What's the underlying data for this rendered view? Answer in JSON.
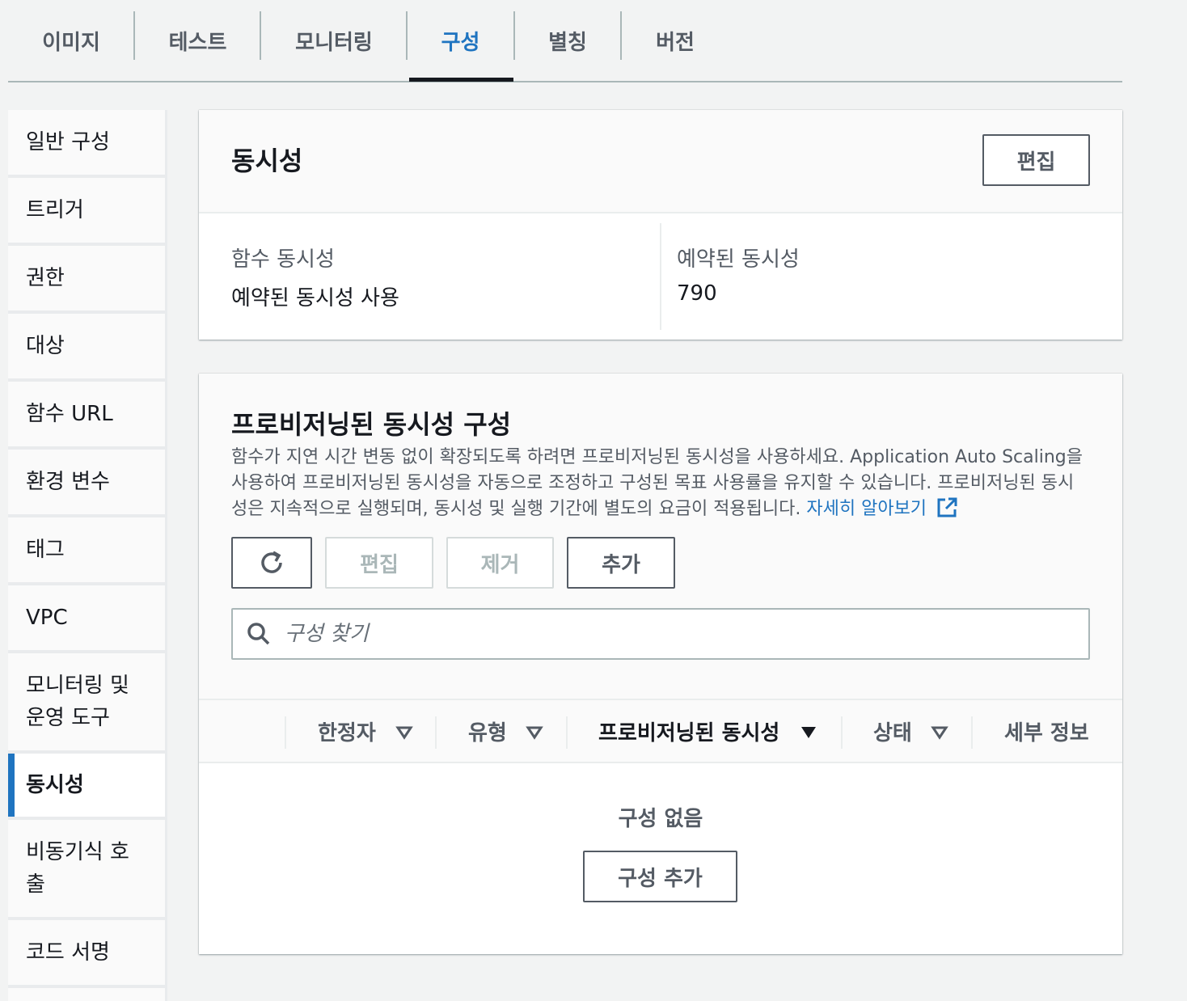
{
  "tabs": [
    "이미지",
    "테스트",
    "모니터링",
    "구성",
    "별칭",
    "버전"
  ],
  "active_tab": "구성",
  "sidebar": {
    "items": [
      {
        "label": "일반 구성"
      },
      {
        "label": "트리거"
      },
      {
        "label": "권한"
      },
      {
        "label": "대상"
      },
      {
        "label": "함수 URL"
      },
      {
        "label": "환경 변수"
      },
      {
        "label": "태그"
      },
      {
        "label": "VPC"
      },
      {
        "label": "모니터링 및 운영 도구"
      },
      {
        "label": "동시성"
      },
      {
        "label": "비동기식 호출"
      },
      {
        "label": "코드 서명"
      }
    ],
    "active": "동시성"
  },
  "concurrency": {
    "title": "동시성",
    "edit_label": "편집",
    "function_concurrency_label": "함수 동시성",
    "function_concurrency_value": "예약된 동시성 사용",
    "reserved_concurrency_label": "예약된 동시성",
    "reserved_concurrency_value": "790"
  },
  "provisioned": {
    "title": "프로비저닝된 동시성 구성",
    "description": "함수가 지연 시간 변동 없이 확장되도록 하려면 프로비저닝된 동시성을 사용하세요. Application Auto Scaling을 사용하여 프로비저닝된 동시성을 자동으로 조정하고 구성된 목표 사용률을 유지할 수 있습니다. 프로비저닝된 동시성은 지속적으로 실행되며, 동시성 및 실행 기간에 별도의 요금이 적용됩니다.",
    "learn_more": "자세히 알아보기",
    "buttons": {
      "refresh_icon": "refresh-icon",
      "edit": "편집",
      "remove": "제거",
      "add": "추가"
    },
    "search_placeholder": "구성 찾기",
    "columns": [
      "한정자",
      "유형",
      "프로비저닝된 동시성",
      "상태",
      "세부 정보"
    ],
    "sorted_column": "프로비저닝된 동시성",
    "empty_title": "구성 없음",
    "empty_button": "구성 추가"
  },
  "colors": {
    "accent": "#1f74c0",
    "text": "#16191f",
    "muted": "#545b64",
    "background": "#f2f3f3"
  }
}
